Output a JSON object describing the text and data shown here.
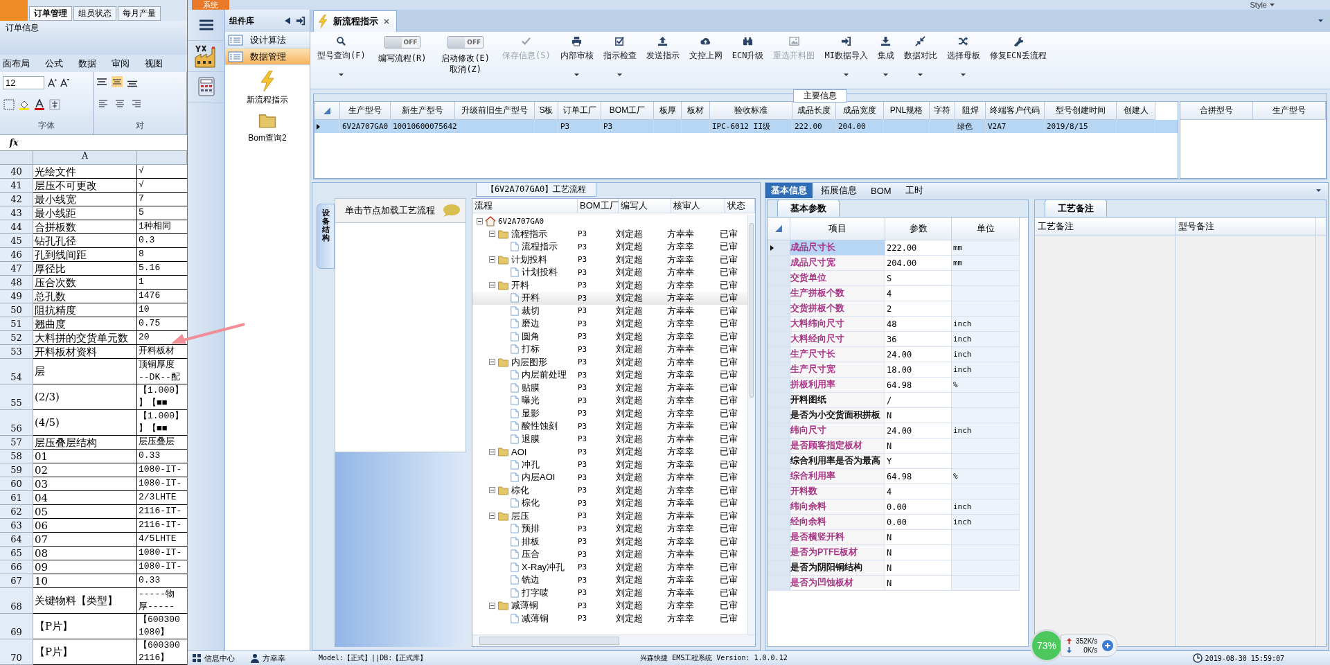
{
  "excel": {
    "top_tabs": [
      {
        "label": "订单管理",
        "selected": true
      },
      {
        "label": "组员状态",
        "selected": false
      },
      {
        "label": "每月产量",
        "selected": false
      }
    ],
    "group_label": "订单信息",
    "menu": [
      "面布局",
      "公式",
      "数据",
      "审阅",
      "视图"
    ],
    "font_size": "12",
    "font_group": "字体",
    "align_group": "对",
    "formula_label": "fx",
    "column_header": "A",
    "rows": [
      {
        "num": "40",
        "a": "光绘文件",
        "b": "√"
      },
      {
        "num": "41",
        "a": "层压不可更改",
        "b": "√"
      },
      {
        "num": "42",
        "a": "最小线宽",
        "b": "7"
      },
      {
        "num": "43",
        "a": "最小线距",
        "b": "5"
      },
      {
        "num": "44",
        "a": "合拼板数",
        "b": "1种相同"
      },
      {
        "num": "45",
        "a": "钻孔孔径",
        "b": "0.3"
      },
      {
        "num": "46",
        "a": "孔到线间距",
        "b": "8"
      },
      {
        "num": "47",
        "a": "厚径比",
        "b": "5.16"
      },
      {
        "num": "48",
        "a": "压合次数",
        "b": "1"
      },
      {
        "num": "49",
        "a": "总孔数",
        "b": "1476"
      },
      {
        "num": "50",
        "a": "阻抗精度",
        "b": "10"
      },
      {
        "num": "51",
        "a": "翘曲度",
        "b": "0.75"
      },
      {
        "num": "52",
        "a": "大料拼的交货单元数",
        "b": "20"
      },
      {
        "num": "53",
        "a": "开料板材资料",
        "b": "开料板材"
      },
      {
        "num": "54",
        "a": "层",
        "b": [
          "顶铜厚度",
          "--DK--配"
        ]
      },
      {
        "num": "55",
        "a": "(2/3)",
        "b": [
          "【1.000】",
          "】【■■"
        ]
      },
      {
        "num": "56",
        "a": "(4/5)",
        "b": [
          "【1.000】",
          "】【■■"
        ]
      },
      {
        "num": "57",
        "a": "层压叠层结构",
        "b": "层压叠层"
      },
      {
        "num": "58",
        "a": "01",
        "b": "0.33"
      },
      {
        "num": "59",
        "a": "02",
        "b": "1080-IT-"
      },
      {
        "num": "60",
        "a": "03",
        "b": "1080-IT-"
      },
      {
        "num": "61",
        "a": "04",
        "b": "2/3LHTE"
      },
      {
        "num": "62",
        "a": "05",
        "b": "2116-IT-"
      },
      {
        "num": "63",
        "a": "06",
        "b": "2116-IT-"
      },
      {
        "num": "64",
        "a": "07",
        "b": "4/5LHTE"
      },
      {
        "num": "65",
        "a": "08",
        "b": "1080-IT-"
      },
      {
        "num": "66",
        "a": "09",
        "b": "1080-IT-"
      },
      {
        "num": "67",
        "a": "10",
        "b": "0.33"
      },
      {
        "num": "68",
        "a": "关键物料【类型】",
        "b": [
          "-----物",
          "厚-----"
        ]
      },
      {
        "num": "69",
        "a": "【P片】",
        "b": [
          "【600300",
          "1080】"
        ]
      },
      {
        "num": "70",
        "a": "【P片】",
        "b": [
          "【600300",
          "2116】"
        ]
      }
    ]
  },
  "app": {
    "system_tab": "系统",
    "style_label": "Style",
    "library": {
      "title": "组件库",
      "items": [
        {
          "label": "设计算法",
          "selected": false
        },
        {
          "label": "数据管理",
          "selected": true
        }
      ],
      "tools": [
        {
          "label": "新流程指示",
          "kind": "lightning"
        },
        {
          "label": "Bom查询2",
          "kind": "folder"
        }
      ]
    },
    "doc_tab": {
      "label": "新流程指示"
    },
    "toolbar": [
      {
        "kind": "button",
        "label": "型号查询(F)",
        "disabled": false,
        "dropdown": true
      },
      {
        "kind": "toggle",
        "label": "编写流程(R)",
        "switch_text": "OFF",
        "on": false
      },
      {
        "kind": "toggle",
        "label": "启动修改(E)\n取消(Z)",
        "switch_text": "OFF",
        "on": false
      },
      {
        "kind": "button",
        "label": "保存信息(S)",
        "disabled": true,
        "dropdown": false
      },
      {
        "kind": "button",
        "label": "内部审核",
        "disabled": false,
        "dropdown": true
      },
      {
        "kind": "button",
        "label": "指示检查",
        "disabled": false,
        "dropdown": true
      },
      {
        "kind": "button",
        "label": "发送指示",
        "disabled": false,
        "dropdown": false
      },
      {
        "kind": "button",
        "label": "文控上网",
        "disabled": false,
        "dropdown": false
      },
      {
        "kind": "button",
        "label": "ECN升级",
        "disabled": false,
        "dropdown": false
      },
      {
        "kind": "button",
        "label": "重选开料图",
        "disabled": true,
        "dropdown": false
      },
      {
        "kind": "button",
        "label": "MI数据导入",
        "disabled": false,
        "dropdown": true
      },
      {
        "kind": "button",
        "label": "集成",
        "disabled": false,
        "dropdown": true
      },
      {
        "kind": "button",
        "label": "数据对比",
        "disabled": false,
        "dropdown": true
      },
      {
        "kind": "button",
        "label": "选择母板",
        "disabled": false,
        "dropdown": true
      },
      {
        "kind": "button",
        "label": "修复ECN丢流程",
        "disabled": false,
        "dropdown": false
      }
    ],
    "main_info": {
      "title": "主要信息",
      "columns": [
        "生产型号",
        "新生产型号",
        "升级前旧生产型号",
        "S板",
        "订单工厂",
        "BOM工厂",
        "板厚",
        "板材",
        "验收标准",
        "成品长度",
        "成品宽度",
        "PNL规格",
        "字符",
        "阻焊",
        "终端客户代码",
        "型号创建时间",
        "创建人"
      ],
      "rows": [
        {
          "selected": true,
          "cells": [
            "6V2A707GA0",
            "10010600075642",
            null,
            null,
            "P3",
            "P3",
            null,
            null,
            "IPC-6012 II级",
            "222.00",
            "204.00",
            null,
            null,
            "绿色",
            "V2A7",
            "2019/8/15",
            null
          ]
        }
      ],
      "side_columns": [
        "合拼型号",
        "生产型号"
      ]
    },
    "process": {
      "title": "【6V2A707GA0】工艺流程",
      "side_tab": "设备结构",
      "hint": "单击节点加载工艺流程",
      "columns": [
        "流程",
        "BOM工厂",
        "编写人",
        "核审人",
        "状态"
      ],
      "tree": [
        {
          "label": "6V2A707GA0",
          "expanded": true,
          "selected": false,
          "children": [
            {
              "label": "流程指示",
              "bom": "P3",
              "writer": "刘定超",
              "reviewer": "方幸幸",
              "status": "已审",
              "expanded": true,
              "selected": false,
              "children": [
                {
                  "label": "流程指示",
                  "bom": "P3",
                  "writer": "刘定超",
                  "reviewer": "方幸幸",
                  "status": "已审",
                  "selected": false
                }
              ]
            },
            {
              "label": "计划投料",
              "bom": "P3",
              "writer": "刘定超",
              "reviewer": "方幸幸",
              "status": "已审",
              "expanded": true,
              "selected": false,
              "children": [
                {
                  "label": "计划投料",
                  "bom": "P3",
                  "writer": "刘定超",
                  "reviewer": "方幸幸",
                  "status": "已审",
                  "selected": false
                }
              ]
            },
            {
              "label": "开料",
              "bom": "P3",
              "writer": "刘定超",
              "reviewer": "方幸幸",
              "status": "已审",
              "expanded": true,
              "selected": false,
              "children": [
                {
                  "label": "开料",
                  "bom": "P3",
                  "writer": "刘定超",
                  "reviewer": "方幸幸",
                  "status": "已审",
                  "selected": true
                },
                {
                  "label": "裁切",
                  "bom": "P3",
                  "writer": "刘定超",
                  "reviewer": "方幸幸",
                  "status": "已审",
                  "selected": false
                },
                {
                  "label": "磨边",
                  "bom": "P3",
                  "writer": "刘定超",
                  "reviewer": "方幸幸",
                  "status": "已审",
                  "selected": false
                },
                {
                  "label": "圆角",
                  "bom": "P3",
                  "writer": "刘定超",
                  "reviewer": "方幸幸",
                  "status": "已审",
                  "selected": false
                },
                {
                  "label": "打标",
                  "bom": "P3",
                  "writer": "刘定超",
                  "reviewer": "方幸幸",
                  "status": "已审",
                  "selected": false
                }
              ]
            },
            {
              "label": "内层图形",
              "bom": "P3",
              "writer": "刘定超",
              "reviewer": "方幸幸",
              "status": "已审",
              "expanded": true,
              "selected": false,
              "children": [
                {
                  "label": "内层前处理",
                  "bom": "P3",
                  "writer": "刘定超",
                  "reviewer": "方幸幸",
                  "status": "已审",
                  "selected": false
                },
                {
                  "label": "贴膜",
                  "bom": "P3",
                  "writer": "刘定超",
                  "reviewer": "方幸幸",
                  "status": "已审",
                  "selected": false
                },
                {
                  "label": "曝光",
                  "bom": "P3",
                  "writer": "刘定超",
                  "reviewer": "方幸幸",
                  "status": "已审",
                  "selected": false
                },
                {
                  "label": "显影",
                  "bom": "P3",
                  "writer": "刘定超",
                  "reviewer": "方幸幸",
                  "status": "已审",
                  "selected": false
                },
                {
                  "label": "酸性蚀刻",
                  "bom": "P3",
                  "writer": "刘定超",
                  "reviewer": "方幸幸",
                  "status": "已审",
                  "selected": false
                },
                {
                  "label": "退膜",
                  "bom": "P3",
                  "writer": "刘定超",
                  "reviewer": "方幸幸",
                  "status": "已审",
                  "selected": false
                }
              ]
            },
            {
              "label": "AOI",
              "bom": "P3",
              "writer": "刘定超",
              "reviewer": "方幸幸",
              "status": "已审",
              "expanded": true,
              "selected": false,
              "children": [
                {
                  "label": "冲孔",
                  "bom": "P3",
                  "writer": "刘定超",
                  "reviewer": "方幸幸",
                  "status": "已审",
                  "selected": false
                },
                {
                  "label": "内层AOI",
                  "bom": "P3",
                  "writer": "刘定超",
                  "reviewer": "方幸幸",
                  "status": "已审",
                  "selected": false
                }
              ]
            },
            {
              "label": "棕化",
              "bom": "P3",
              "writer": "刘定超",
              "reviewer": "方幸幸",
              "status": "已审",
              "expanded": true,
              "selected": false,
              "children": [
                {
                  "label": "棕化",
                  "bom": "P3",
                  "writer": "刘定超",
                  "reviewer": "方幸幸",
                  "status": "已审",
                  "selected": false
                }
              ]
            },
            {
              "label": "层压",
              "bom": "P3",
              "writer": "刘定超",
              "reviewer": "方幸幸",
              "status": "已审",
              "expanded": true,
              "selected": false,
              "children": [
                {
                  "label": "预排",
                  "bom": "P3",
                  "writer": "刘定超",
                  "reviewer": "方幸幸",
                  "status": "已审",
                  "selected": false
                },
                {
                  "label": "排板",
                  "bom": "P3",
                  "writer": "刘定超",
                  "reviewer": "方幸幸",
                  "status": "已审",
                  "selected": false
                },
                {
                  "label": "压合",
                  "bom": "P3",
                  "writer": "刘定超",
                  "reviewer": "方幸幸",
                  "status": "已审",
                  "selected": false
                },
                {
                  "label": "X-Ray冲孔",
                  "bom": "P3",
                  "writer": "刘定超",
                  "reviewer": "方幸幸",
                  "status": "已审",
                  "selected": false
                },
                {
                  "label": "铣边",
                  "bom": "P3",
                  "writer": "刘定超",
                  "reviewer": "方幸幸",
                  "status": "已审",
                  "selected": false
                },
                {
                  "label": "打字唛",
                  "bom": "P3",
                  "writer": "刘定超",
                  "reviewer": "方幸幸",
                  "status": "已审",
                  "selected": false
                }
              ]
            },
            {
              "label": "减薄铜",
              "bom": "P3",
              "writer": "刘定超",
              "reviewer": "方幸幸",
              "status": "已审",
              "expanded": true,
              "selected": false,
              "children": [
                {
                  "label": "减薄铜",
                  "bom": "P3",
                  "writer": "刘定超",
                  "reviewer": "方幸幸",
                  "status": "已审",
                  "selected": false
                }
              ]
            }
          ]
        }
      ]
    },
    "info": {
      "tabs": [
        {
          "label": "基本信息",
          "selected": true
        },
        {
          "label": "拓展信息",
          "selected": false
        },
        {
          "label": "BOM",
          "selected": false
        },
        {
          "label": "工时",
          "selected": false
        }
      ],
      "params_tab": "基本参数",
      "columns": [
        "项目",
        "参数",
        "单位"
      ],
      "rows": [
        {
          "name": "成品尺寸长",
          "value": "222.00",
          "unit": "mm",
          "color": "#a4287e",
          "selected": true
        },
        {
          "name": "成品尺寸宽",
          "value": "204.00",
          "unit": "mm",
          "color": "#a4287e",
          "selected": false
        },
        {
          "name": "交货单位",
          "value": "S",
          "color": "#a4287e",
          "selected": false
        },
        {
          "name": "生产拼板个数",
          "value": "4",
          "color": "#a4287e",
          "selected": false
        },
        {
          "name": "交货拼板个数",
          "value": "2",
          "color": "#a4287e",
          "selected": false
        },
        {
          "name": "大料纬向尺寸",
          "value": "48",
          "unit": "inch",
          "color": "#a4287e",
          "selected": false
        },
        {
          "name": "大料经向尺寸",
          "value": "36",
          "unit": "inch",
          "color": "#a4287e",
          "selected": false
        },
        {
          "name": "生产尺寸长",
          "value": "24.00",
          "unit": "inch",
          "color": "#a4287e",
          "selected": false
        },
        {
          "name": "生产尺寸宽",
          "value": "18.00",
          "unit": "inch",
          "color": "#a4287e",
          "selected": false
        },
        {
          "name": "拼板利用率",
          "value": "64.98",
          "unit": "%",
          "color": "#a4287e",
          "selected": false
        },
        {
          "name": "开料图纸",
          "value": "/",
          "color": "#000000",
          "selected": false
        },
        {
          "name": "是否为小交货面积拼板",
          "value": "N",
          "color": "#000000",
          "selected": false
        },
        {
          "name": "纬向尺寸",
          "value": "24.00",
          "unit": "inch",
          "color": "#a4287e",
          "selected": false
        },
        {
          "name": "是否顾客指定板材",
          "value": "N",
          "color": "#a4287e",
          "selected": false
        },
        {
          "name": "综合利用率是否为最高",
          "value": "Y",
          "color": "#000000",
          "selected": false
        },
        {
          "name": "综合利用率",
          "value": "64.98",
          "unit": "%",
          "color": "#a4287e",
          "selected": false
        },
        {
          "name": "开料数",
          "value": "4",
          "color": "#a4287e",
          "selected": false
        },
        {
          "name": "纬向余料",
          "value": "0.00",
          "unit": "inch",
          "color": "#a4287e",
          "selected": false
        },
        {
          "name": "经向余料",
          "value": "0.00",
          "unit": "inch",
          "color": "#a4287e",
          "selected": false
        },
        {
          "name": "是否横竖开料",
          "value": "N",
          "color": "#a4287e",
          "selected": false
        },
        {
          "name": "是否为PTFE板材",
          "value": "N",
          "color": "#a4287e",
          "selected": false
        },
        {
          "name": "是否为阴阳铜结构",
          "value": "N",
          "color": "#000000",
          "selected": false
        },
        {
          "name": "是否为凹蚀板材",
          "value": "N",
          "color": "#a4287e",
          "selected": false
        }
      ],
      "notes_tab": "工艺备注",
      "notes_columns": [
        "工艺备注",
        "型号备注"
      ]
    },
    "status_bar": {
      "info_center": "信息中心",
      "user": "方幸幸",
      "model": "Model:【正式】||DB:【正式库】",
      "version": "兴森快捷 EMS工程系统 Version: 1.0.0.12",
      "datetime": "2019-08-30 15:59:07"
    },
    "network": {
      "percent": "73%",
      "up": "352K/s",
      "down": "0K/s"
    }
  }
}
